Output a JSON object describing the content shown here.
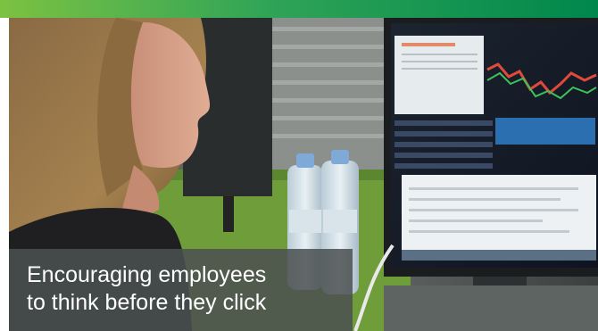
{
  "image": {
    "description_alt": "",
    "accent_colors": {
      "stripe_start": "#7cc242",
      "stripe_end": "#00874c",
      "caption_background": "#4a5050",
      "caption_text": "#ffffff"
    }
  },
  "caption": {
    "line1": "Encouraging employees",
    "line2": "to think before they click"
  }
}
